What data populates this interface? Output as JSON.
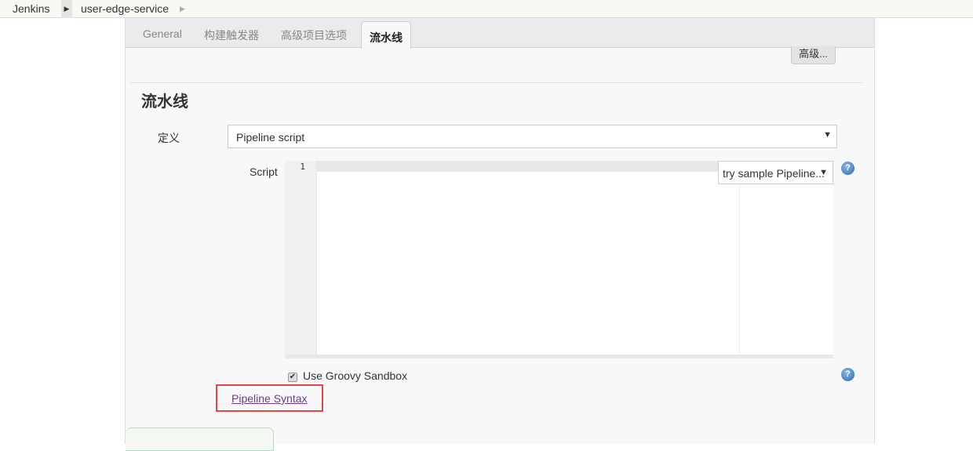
{
  "breadcrumb": {
    "items": [
      "Jenkins",
      "user-edge-service"
    ]
  },
  "tabs": [
    {
      "label": "General"
    },
    {
      "label": "构建触发器"
    },
    {
      "label": "高级项目选项"
    },
    {
      "label": "流水线",
      "active": true
    }
  ],
  "advanced_button": "高级...",
  "section_title": "流水线",
  "definition": {
    "label": "定义",
    "value": "Pipeline script"
  },
  "script": {
    "label": "Script",
    "line_numbers": [
      "1"
    ],
    "sample_select": "try sample Pipeline..."
  },
  "sandbox": {
    "label": "Use Groovy Sandbox",
    "checked": true
  },
  "pipeline_syntax_link": "Pipeline Syntax",
  "help": "?"
}
